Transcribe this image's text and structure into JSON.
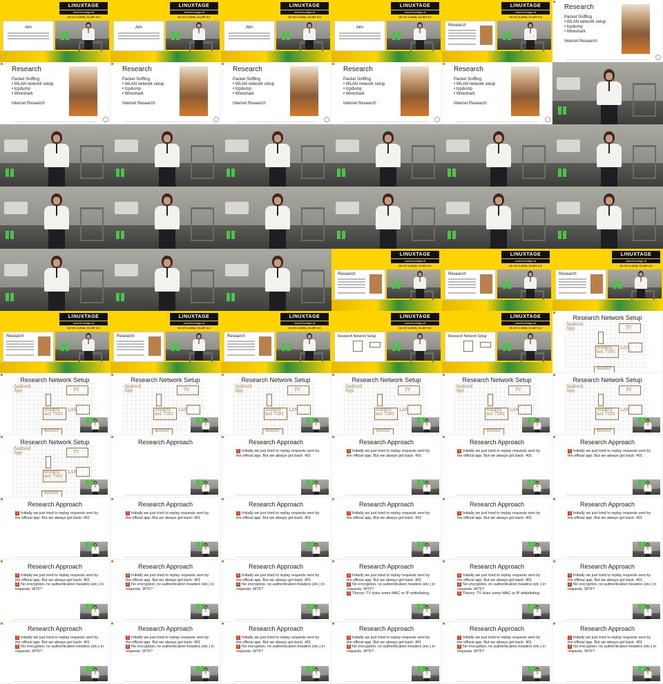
{
  "banner": {
    "brand": "LINUXTAGE",
    "url": "www.linuxtage.at",
    "date": "26.+27.4.2018, CC-BY 3.0"
  },
  "slides": {
    "aim_title": "Aim",
    "research_title": "Research",
    "research_items": [
      "Packet Sniffing",
      "• WLAN network setup",
      "• tcpdump",
      "• Wireshark"
    ],
    "research_footer": "Internet Research",
    "network_title": "Research Network Setup",
    "network_labels": {
      "app": "Android App",
      "tv": "TV",
      "soekris": "Soekris net 7501",
      "lan": "LAN",
      "router": "Router"
    },
    "approach_title": "Research Approach",
    "approach_items": [
      {
        "num": "1",
        "lines": [
          "Initially we just tried to replay requests sent by",
          "the official app. But we always got back: 401"
        ]
      },
      {
        "num": "2",
        "lines": [
          "No encryption, no authentication headers (etc.) in",
          "requests. WTF?"
        ]
      },
      {
        "num": "3",
        "lines": [
          "Theory: TV does some MAC or IP whitelisting."
        ]
      }
    ]
  },
  "tiles": [
    {
      "kind": "banner",
      "slide": "aim"
    },
    {
      "kind": "banner",
      "slide": "aim"
    },
    {
      "kind": "banner",
      "slide": "aim"
    },
    {
      "kind": "banner",
      "slide": "aim"
    },
    {
      "kind": "banner",
      "slide": "research"
    },
    {
      "kind": "research"
    },
    {
      "kind": "research"
    },
    {
      "kind": "research"
    },
    {
      "kind": "research"
    },
    {
      "kind": "research"
    },
    {
      "kind": "research"
    },
    {
      "kind": "photo"
    },
    {
      "kind": "photo"
    },
    {
      "kind": "photo"
    },
    {
      "kind": "photo"
    },
    {
      "kind": "photo"
    },
    {
      "kind": "photo"
    },
    {
      "kind": "photo"
    },
    {
      "kind": "photo"
    },
    {
      "kind": "photo"
    },
    {
      "kind": "photo"
    },
    {
      "kind": "photo"
    },
    {
      "kind": "photo"
    },
    {
      "kind": "photo"
    },
    {
      "kind": "photo"
    },
    {
      "kind": "photo"
    },
    {
      "kind": "photo"
    },
    {
      "kind": "banner",
      "slide": "research"
    },
    {
      "kind": "banner",
      "slide": "research"
    },
    {
      "kind": "banner",
      "slide": "research"
    },
    {
      "kind": "banner",
      "slide": "research"
    },
    {
      "kind": "banner",
      "slide": "research"
    },
    {
      "kind": "banner",
      "slide": "research"
    },
    {
      "kind": "banner",
      "slide": "network"
    },
    {
      "kind": "banner",
      "slide": "network"
    },
    {
      "kind": "network",
      "pip": false
    },
    {
      "kind": "network",
      "pip": true
    },
    {
      "kind": "network",
      "pip": true
    },
    {
      "kind": "network",
      "pip": true
    },
    {
      "kind": "network",
      "pip": true
    },
    {
      "kind": "network",
      "pip": true
    },
    {
      "kind": "network",
      "pip": true
    },
    {
      "kind": "network",
      "pip": true
    },
    {
      "kind": "approach",
      "n": 0
    },
    {
      "kind": "approach",
      "n": 1
    },
    {
      "kind": "approach",
      "n": 1
    },
    {
      "kind": "approach",
      "n": 1
    },
    {
      "kind": "approach",
      "n": 1
    },
    {
      "kind": "approach",
      "n": 1
    },
    {
      "kind": "approach",
      "n": 1
    },
    {
      "kind": "approach",
      "n": 1
    },
    {
      "kind": "approach",
      "n": 1
    },
    {
      "kind": "approach",
      "n": 1
    },
    {
      "kind": "approach",
      "n": 1
    },
    {
      "kind": "approach",
      "n": 2
    },
    {
      "kind": "approach",
      "n": 2
    },
    {
      "kind": "approach",
      "n": 2
    },
    {
      "kind": "approach",
      "n": 3
    },
    {
      "kind": "approach",
      "n": 3
    },
    {
      "kind": "approach",
      "n": 2
    },
    {
      "kind": "approach",
      "n": 2
    },
    {
      "kind": "approach",
      "n": 2
    },
    {
      "kind": "approach",
      "n": 2
    },
    {
      "kind": "approach",
      "n": 2
    },
    {
      "kind": "approach",
      "n": 2
    },
    {
      "kind": "approach",
      "n": 2
    }
  ]
}
